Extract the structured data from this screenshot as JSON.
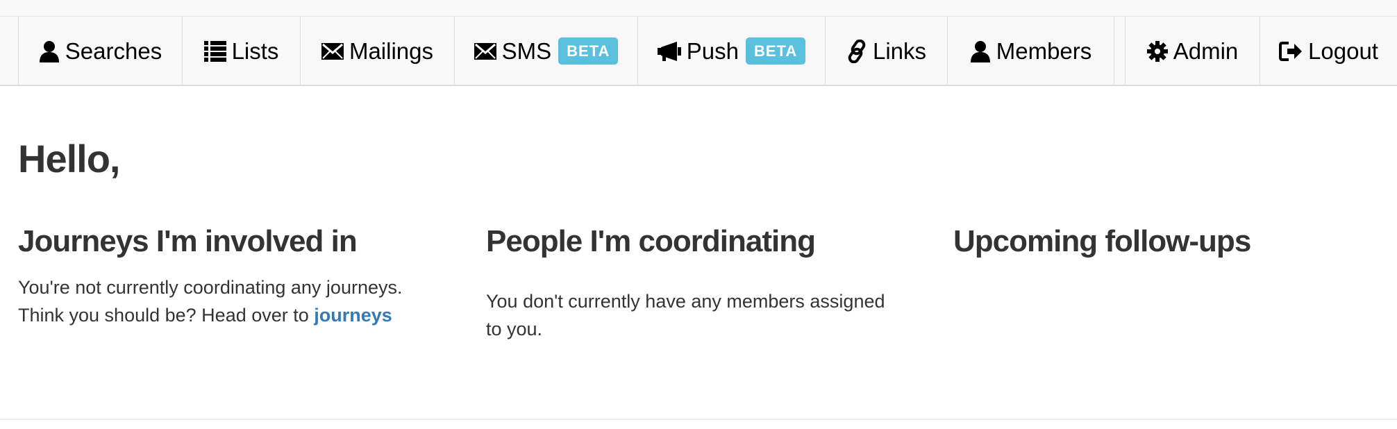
{
  "nav": {
    "items": [
      {
        "label": "Searches",
        "icon": "user-icon"
      },
      {
        "label": "Lists",
        "icon": "list-icon"
      },
      {
        "label": "Mailings",
        "icon": "envelope-icon"
      },
      {
        "label": "SMS",
        "icon": "envelope-icon",
        "badge": "BETA"
      },
      {
        "label": "Push",
        "icon": "bullhorn-icon",
        "badge": "BETA"
      },
      {
        "label": "Links",
        "icon": "link-icon"
      },
      {
        "label": "Members",
        "icon": "user-icon"
      },
      {
        "label": "Admin",
        "icon": "gear-icon"
      },
      {
        "label": "Logout",
        "icon": "logout-icon"
      }
    ],
    "badge_color": "#5bc0de"
  },
  "main": {
    "greeting": "Hello,",
    "journeys": {
      "heading": "Journeys I'm involved in",
      "text_before_link": "You're not currently coordinating any journeys. Think you should be? Head over to ",
      "link_text": "journeys"
    },
    "people": {
      "heading": "People I'm coordinating",
      "text": "You don't currently have any members assigned to you."
    },
    "followups": {
      "heading": "Upcoming follow-ups"
    }
  },
  "colors": {
    "link": "#337ab7",
    "navbar_bg": "#f8f8f8",
    "text": "#333333"
  }
}
